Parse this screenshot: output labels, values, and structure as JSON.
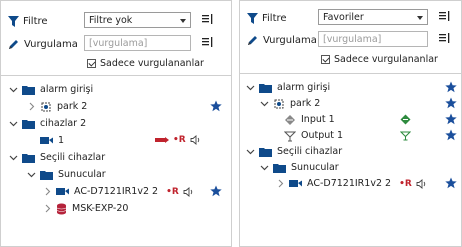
{
  "panels": [
    {
      "filter": {
        "label": "Filtre",
        "value": "Filtre yok"
      },
      "highlight": {
        "label": "Vurgulama",
        "placeholder": "[vurgulama]"
      },
      "only_highlighted": {
        "label": "Sadece vurgulananlar",
        "checked": true
      },
      "tree": {
        "alarm_group": "alarm girişi",
        "park": "park 2",
        "cihazlar_group": "cihazlar 2",
        "camera_1": "1",
        "selected_group": "Seçili cihazlar",
        "servers": "Sunucular",
        "camera_ac": "AC-D7121IR1v2 2",
        "msk": "MSK-EXP-20",
        "rec_mark": "•R"
      }
    },
    {
      "filter": {
        "label": "Filtre",
        "value": "Favoriler"
      },
      "highlight": {
        "label": "Vurgulama",
        "placeholder": "[vurgulama]"
      },
      "only_highlighted": {
        "label": "Sadece vurgulananlar",
        "checked": true
      },
      "tree": {
        "alarm_group": "alarm girişi",
        "park": "park 2",
        "input": "Input 1",
        "output": "Output 1",
        "selected_group": "Seçili cihazlar",
        "servers": "Sunucular",
        "camera_ac": "AC-D7121IR1v2 2",
        "rec_mark": "•R"
      }
    }
  ],
  "colors": {
    "accent": "#0f4a8a",
    "star": "#1b4f9c",
    "rec": "#c0232d",
    "input_icon": "#2e8b3e",
    "msk_icon": "#b5233b"
  },
  "icons": [
    "filter-icon",
    "pencil-icon",
    "list-toggle-icon",
    "folder-icon",
    "camera-icon",
    "park-icon",
    "star-icon",
    "speaker-icon",
    "database-icon",
    "diamond-input-icon",
    "output-icon",
    "chevron-down-icon",
    "chevron-right-icon"
  ]
}
